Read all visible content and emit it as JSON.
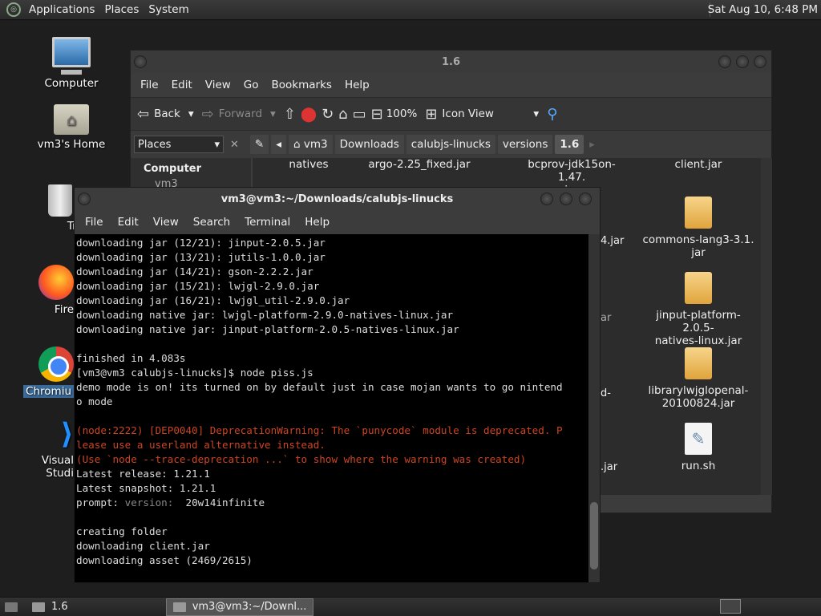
{
  "top_panel": {
    "menus": [
      "Applications",
      "Places",
      "System"
    ],
    "clock": "Sat Aug 10,  6:48 PM"
  },
  "desktop": {
    "icons": [
      "Computer",
      "vm3's Home",
      "Tra",
      "Fire",
      "Chromiu",
      "Visual Studi"
    ]
  },
  "file_manager": {
    "title": "1.6",
    "menus": [
      "File",
      "Edit",
      "View",
      "Go",
      "Bookmarks",
      "Help"
    ],
    "toolbar": {
      "back": "Back",
      "forward": "Forward",
      "zoom": "100%",
      "view_mode": "Icon View"
    },
    "places_label": "Places",
    "sidebar_header": "Computer",
    "sidebar_item": "vm3",
    "breadcrumbs": [
      "vm3",
      "Downloads",
      "calubjs-linucks",
      "versions",
      "1.6"
    ],
    "files": [
      {
        "name": "natives"
      },
      {
        "name": "argo-2.25_fixed.jar"
      },
      {
        "name": "bcprov-jdk15on-1.47.",
        "name2": "jar"
      },
      {
        "name": "client.jar"
      },
      {
        "name": "commons-lang3-3.1.",
        "name2": "jar"
      },
      {
        "name": "jinput-platform-2.0.5-",
        "name2": "natives-linux.jar"
      },
      {
        "name": "librarylwjglopenal-",
        "name2": "20100824.jar"
      },
      {
        "name": "run.sh"
      }
    ],
    "partial_labels": [
      "4.jar",
      "ar",
      "d-",
      ".jar"
    ]
  },
  "terminal": {
    "title": "vm3@vm3:~/Downloads/calubjs-linucks",
    "menus": [
      "File",
      "Edit",
      "View",
      "Search",
      "Terminal",
      "Help"
    ],
    "lines": [
      "downloading jar (12/21): jinput-2.0.5.jar",
      "downloading jar (13/21): jutils-1.0.0.jar",
      "downloading jar (14/21): gson-2.2.2.jar",
      "downloading jar (15/21): lwjgl-2.9.0.jar",
      "downloading jar (16/21): lwjgl_util-2.9.0.jar",
      "downloading native jar: lwjgl-platform-2.9.0-natives-linux.jar",
      "downloading native jar: jinput-platform-2.0.5-natives-linux.jar",
      "",
      "finished in 4.083s",
      "[vm3@vm3 calubjs-linucks]$ node piss.js",
      "demo mode is on! its turned on by default just in case mojan wants to go nintend",
      "o mode",
      ""
    ],
    "warning_lines": [
      "(node:2222) [DEP0040] DeprecationWarning: The `punycode` module is deprecated. P",
      "lease use a userland alternative instead.",
      "(Use `node --trace-deprecation ...` to show where the warning was created)"
    ],
    "release_line": "Latest release: 1.21.1",
    "snapshot_line": "Latest snapshot: 1.21.1",
    "prompt_prefix": "prompt: ",
    "prompt_version_label": "version: ",
    "prompt_value": " 20w14infinite",
    "tail_lines": [
      "",
      "creating folder",
      "downloading client.jar",
      "downloading asset (2469/2615)"
    ]
  },
  "bottom_panel": {
    "tasks": [
      "1.6",
      "vm3@vm3:~/Downl..."
    ]
  }
}
